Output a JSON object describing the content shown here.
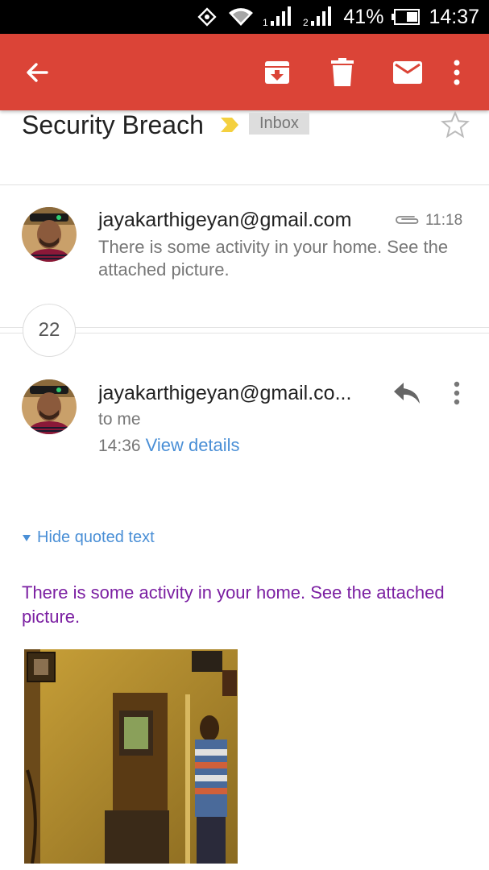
{
  "status_bar": {
    "battery_percent": "41%",
    "time": "14:37",
    "icons": [
      "rotate-icon",
      "wifi-icon",
      "signal-1-icon",
      "signal-2-icon",
      "battery-icon"
    ]
  },
  "app_bar": {
    "color": "#db4437",
    "actions": [
      "back-arrow-icon",
      "archive-icon",
      "delete-icon",
      "mail-icon",
      "overflow-menu-icon"
    ]
  },
  "thread": {
    "subject": "Security Breach",
    "label": "Inbox",
    "collapsed_message": {
      "sender": "jayakarthigeyan@gmail.com",
      "time": "11:18",
      "snippet": "There is some activity in your home. See the attached picture."
    },
    "hidden_count": "22",
    "expanded_message": {
      "sender": "jayakarthigeyan@gmail.co...",
      "recipient": "to me",
      "time": "14:36",
      "view_details": "View details",
      "hide_quoted": "Hide quoted text",
      "body": "There is some activity in your home. See the attached picture."
    }
  },
  "colors": {
    "accent_red": "#db4437",
    "link_blue": "#4a8fd6",
    "body_purple": "#7b1fa2",
    "importance_yellow": "#f4d03f"
  }
}
